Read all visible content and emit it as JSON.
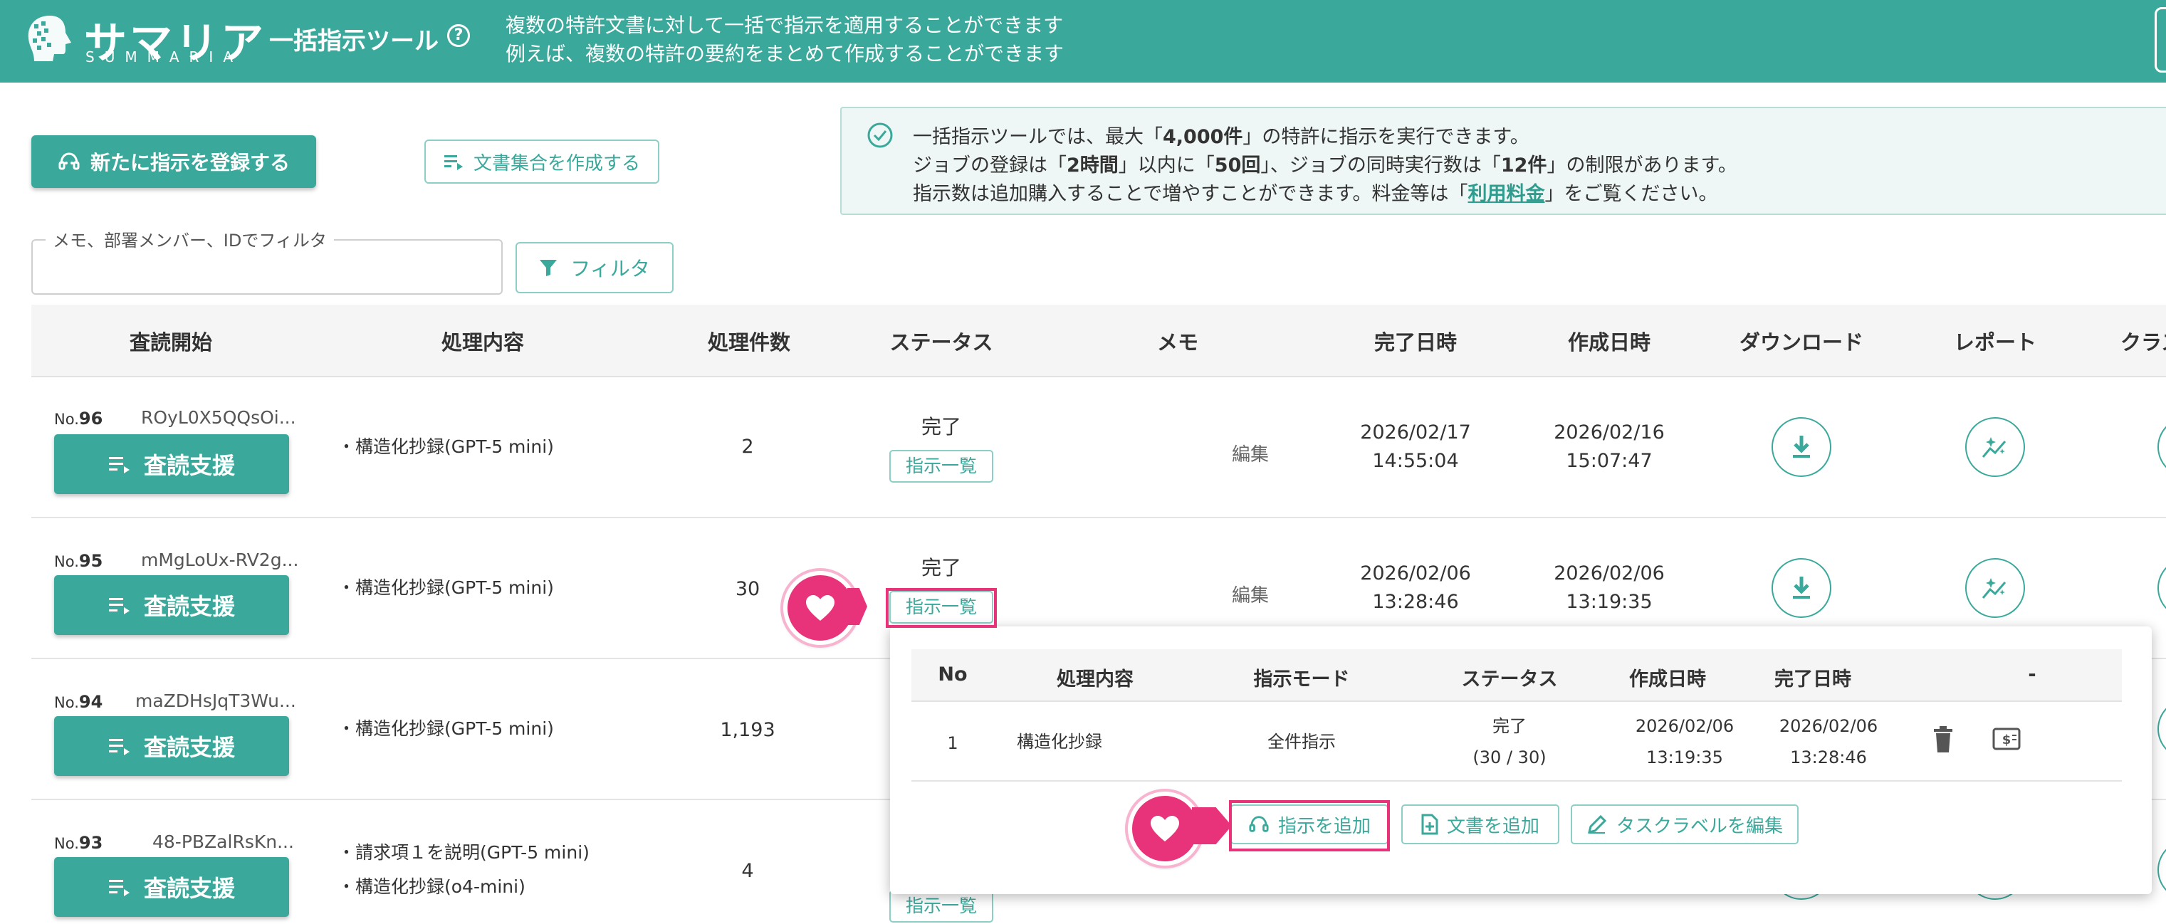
{
  "app": {
    "logo_jp": "サマリア",
    "logo_en": "SUMMARIA",
    "tool_title": "一括指示ツール",
    "description_line1": "複数の特許文書に対して一括で指示を適用することができます",
    "description_line2": "例えば、複数の特許の要約をまとめて作成することができます"
  },
  "toolbar": {
    "new_instruction_label": "新たに指示を登録する",
    "create_docset_label": "文書集合を作成する"
  },
  "info": {
    "line1_pre": "一括指示ツールでは、最大「",
    "line1_bold": "4,000件",
    "line1_post": "」の特許に指示を実行できます。",
    "line2_a": "ジョブの登録は「",
    "line2_b": "2時間",
    "line2_c": "」以内に「",
    "line2_d": "50回",
    "line2_e": "」、ジョブの同時実行数は「",
    "line2_f": "12件",
    "line2_g": "」の制限があります。",
    "line3_pre": "指示数は追加購入することで増やすことができます。料金等は「",
    "line3_link": "利用料金",
    "line3_post": "」をご覧ください。"
  },
  "filter": {
    "label": "メモ、部署メンバー、IDでフィルタ",
    "value": "",
    "button_label": "フィルタ"
  },
  "table": {
    "headers": [
      "査読開始",
      "処理内容",
      "処理件数",
      "ステータス",
      "メモ",
      "完了日時",
      "作成日時",
      "ダウンロード",
      "レポート",
      "クラス"
    ],
    "review_button_label": "査読支援",
    "no_prefix": "No.",
    "rows": [
      {
        "no": "96",
        "id": "ROyL0X5QQsOi...",
        "process": [
          "・構造化抄録(GPT-5 mini)"
        ],
        "count": "2",
        "status": "完了",
        "list_label": "指示一覧",
        "memo": "編集",
        "done_date": "2026/02/17",
        "done_time": "14:55:04",
        "created_date": "2026/02/16",
        "created_time": "15:07:47"
      },
      {
        "no": "95",
        "id": "mMgLoUx-RV2g...",
        "process": [
          "・構造化抄録(GPT-5 mini)"
        ],
        "count": "30",
        "status": "完了",
        "list_label": "指示一覧",
        "memo": "編集",
        "done_date": "2026/02/06",
        "done_time": "13:28:46",
        "created_date": "2026/02/06",
        "created_time": "13:19:35"
      },
      {
        "no": "94",
        "id": "maZDHsJqT3Wu...",
        "process": [
          "・構造化抄録(GPT-5 mini)"
        ],
        "count": "1,193"
      },
      {
        "no": "93",
        "id": "48-PBZalRsKn...",
        "process": [
          "・請求項１を説明(GPT-5 mini)",
          "・構造化抄録(o4-mini)"
        ],
        "count": "4",
        "list_label": "指示一覧"
      }
    ]
  },
  "popup": {
    "headers": [
      "No",
      "処理内容",
      "指示モード",
      "ステータス",
      "作成日時",
      "完了日時",
      "-"
    ],
    "row": {
      "no": "1",
      "process": "構造化抄録",
      "mode": "全件指示",
      "status": "完了",
      "progress": "(30 / 30)",
      "created_date": "2026/02/06",
      "created_time": "13:19:35",
      "done_date": "2026/02/06",
      "done_time": "13:28:46"
    },
    "add_instruction_label": "指示を追加",
    "add_document_label": "文書を追加",
    "edit_task_label": "タスクラベルを編集"
  },
  "colors": {
    "brand": "#3aa99b",
    "highlight": "#e8337a",
    "info_bg": "#eef7f5"
  }
}
